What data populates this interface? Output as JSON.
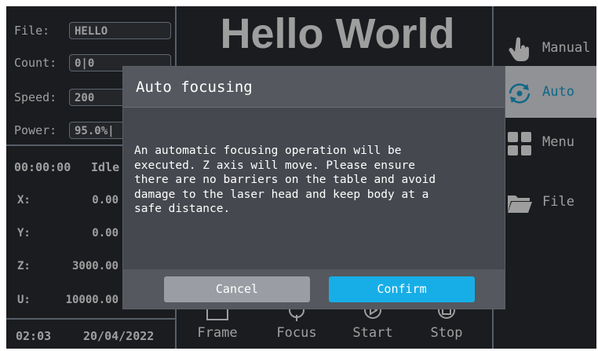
{
  "title": "Hello World",
  "status": {
    "file_label": "File:",
    "file_value": "HELLO",
    "count_label": "Count:",
    "count_value": "0|0",
    "speed_label": "Speed:",
    "speed_value": "200",
    "power_label": "Power:",
    "power_value": "95.0%|",
    "timer": "00:00:00",
    "state": "Idle"
  },
  "coords": [
    {
      "label": "X:",
      "value": "0.00"
    },
    {
      "label": "Y:",
      "value": "0.00"
    },
    {
      "label": "Z:",
      "value": "3000.00"
    },
    {
      "label": "U:",
      "value": "10000.00"
    }
  ],
  "footer": {
    "time": "02:03",
    "date": "20/04/2022"
  },
  "right_menu": [
    {
      "label": "Manual",
      "icon": "hand-pointer-icon"
    },
    {
      "label": "Auto",
      "icon": "auto-focus-icon",
      "active": true
    },
    {
      "label": "Menu",
      "icon": "grid-icon"
    },
    {
      "label": "File",
      "icon": "folder-icon"
    }
  ],
  "toolbar": [
    {
      "label": "Frame",
      "icon": "frame-icon"
    },
    {
      "label": "Focus",
      "icon": "focus-icon"
    },
    {
      "label": "Start",
      "icon": "play-icon"
    },
    {
      "label": "Stop",
      "icon": "stop-icon"
    }
  ],
  "dialog": {
    "title": "Auto focusing",
    "message_lines": [
      "An automatic focusing operation will be",
      "executed. Z axis will move. Please ensure",
      "there are no barriers on the table and avoid",
      "damage to the laser head and keep body at a",
      "safe distance."
    ],
    "cancel_label": "Cancel",
    "confirm_label": "Confirm"
  },
  "colors": {
    "background": "#2b2e33",
    "divider": "#8b98aa",
    "accent": "#17aee7",
    "active_item_bg": "#e8ecf2",
    "dialog_bg": "#45484e",
    "cancel_bg": "#9a9ea4"
  }
}
